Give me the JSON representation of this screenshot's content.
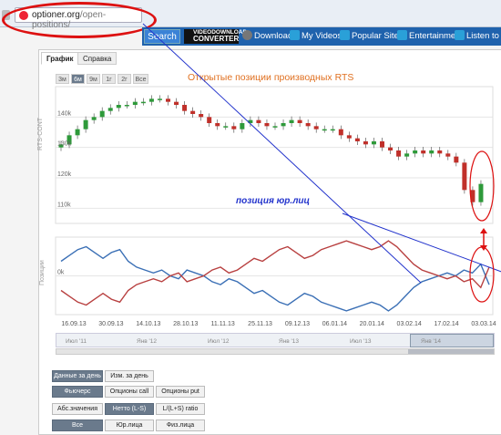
{
  "browser": {
    "url_domain": "optioner.org",
    "url_path": "/open-positions/"
  },
  "toolbar": {
    "search_label": "Search",
    "vd_line1": "VIDEODOWNLOAD",
    "vd_line2": "CONVERTER",
    "items": [
      "Download",
      "My Videos",
      "Popular Sites",
      "Entertainment",
      "Listen to thi"
    ]
  },
  "tabs": [
    "График",
    "Справка"
  ],
  "zoom_buttons": [
    "3м",
    "6м",
    "9м",
    "1г",
    "2г",
    "Все"
  ],
  "chart_title": "Открытые позиции производных RTS",
  "annotation": "позиция юр.лиц",
  "chart_data": [
    {
      "type": "line",
      "title": "Открытые позиции производных RTS",
      "ylabel": "RTS-CONT",
      "y_ticks": [
        "140k",
        "130k",
        "120k",
        "110k"
      ],
      "x_tick_labels": [
        "16.09.13",
        "30.09.13",
        "14.10.13",
        "28.10.13",
        "11.11.13",
        "25.11.13",
        "09.12.13",
        "06.01.14",
        "20.01.14",
        "03.02.14",
        "17.02.14",
        "03.03.14"
      ],
      "series": [
        {
          "values": [
            131,
            134,
            136,
            139,
            140,
            142,
            143,
            144,
            144,
            145,
            145,
            146,
            146,
            145,
            144,
            142,
            141,
            140,
            138,
            137,
            137,
            136,
            138,
            139,
            138,
            137,
            137,
            138,
            139,
            138,
            137,
            136,
            136,
            136,
            134,
            133,
            132,
            131,
            132,
            130,
            129,
            127,
            128,
            129,
            128,
            129,
            128,
            127,
            125,
            116,
            112,
            118
          ]
        }
      ]
    },
    {
      "type": "line",
      "ylabel": "Позиции",
      "y_ticks": [
        "0k"
      ],
      "series": [
        {
          "values": [
            5,
            7,
            9,
            10,
            8,
            6,
            8,
            9,
            5,
            3,
            2,
            1,
            2,
            0,
            -1,
            2,
            1,
            0,
            -2,
            -3,
            -1,
            -2,
            -4,
            -6,
            -5,
            -7,
            -9,
            -10,
            -8,
            -6,
            -7,
            -9,
            -10,
            -11,
            -12,
            -11,
            -10,
            -9,
            -10,
            -12,
            -10,
            -7,
            -4,
            -2,
            -1,
            0,
            1,
            0,
            2,
            1,
            4,
            -3
          ]
        },
        {
          "values": [
            -5,
            -7,
            -9,
            -10,
            -8,
            -6,
            -8,
            -9,
            -5,
            -3,
            -2,
            -1,
            -2,
            0,
            1,
            -2,
            -1,
            0,
            2,
            3,
            1,
            2,
            4,
            6,
            5,
            7,
            9,
            10,
            8,
            6,
            7,
            9,
            10,
            11,
            12,
            11,
            10,
            9,
            10,
            12,
            10,
            7,
            4,
            2,
            1,
            0,
            -1,
            0,
            -2,
            -1,
            -4,
            3
          ]
        }
      ]
    }
  ],
  "navigator_labels": [
    "Июл '11",
    "Янв '12",
    "Июл '12",
    "Янв '13",
    "Июл '13",
    "Янв '14"
  ],
  "filter_rows": [
    [
      "Данные за день",
      "Изм. за день"
    ],
    [
      "Фьючерс",
      "Опционы call",
      "Опционы put"
    ],
    [
      "Абс.значения",
      "Нетто (L-S)",
      "L/(L+S) ratio"
    ],
    [
      "Все",
      "Юр.лица",
      "Физ.лица"
    ]
  ],
  "colors": {
    "up_candle": "#2e9a3a",
    "down_candle": "#c0302a",
    "blue_line": "#3a6fb5",
    "red_line": "#b84040",
    "title": "#e07020",
    "annotation": "#2233cc",
    "toolbar_bg": "#1f62ad"
  }
}
